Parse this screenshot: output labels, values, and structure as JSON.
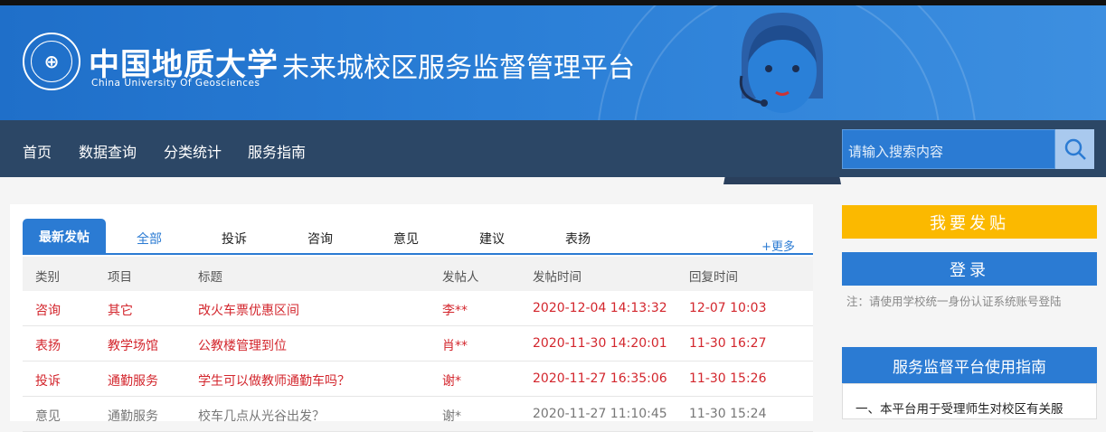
{
  "header": {
    "logo_cn": "中国地质大学",
    "logo_en": "China University Of Geosciences",
    "site_title": "未来城校区服务监督管理平台"
  },
  "nav": {
    "items": [
      "首页",
      "数据查询",
      "分类统计",
      "服务指南"
    ]
  },
  "search": {
    "placeholder": "请输入搜索内容"
  },
  "tabs": {
    "items": [
      "最新发帖",
      "全部",
      "投诉",
      "咨询",
      "意见",
      "建议",
      "表扬"
    ],
    "more": "+更多"
  },
  "table": {
    "headers": [
      "类别",
      "项目",
      "标题",
      "发帖人",
      "发帖时间",
      "回复时间"
    ],
    "rows": [
      [
        "咨询",
        "其它",
        "改火车票优惠区间",
        "李**",
        "2020-12-04 14:13:32",
        "12-07 10:03"
      ],
      [
        "表扬",
        "教学场馆",
        "公教楼管理到位",
        "肖**",
        "2020-11-30 14:20:01",
        "11-30 16:27"
      ],
      [
        "投诉",
        "通勤服务",
        "学生可以做教师通勤车吗？",
        "谢*",
        "2020-11-27 16:35:06",
        "11-30 15:26"
      ],
      [
        "意见",
        "通勤服务",
        "校车几点从光谷出发？",
        "谢*",
        "2020-11-27 11:10:45",
        "11-30 15:24"
      ]
    ]
  },
  "sidebar": {
    "post_button": "我要发贴",
    "login_button": "登录",
    "note": "注：请使用学校统一身份认证系统账号登陆",
    "guide_title": "服务监督平台使用指南",
    "guide_text": "一、本平台用于受理师生对校区有关服"
  },
  "colors": {
    "accent": "#2b7bd3",
    "nav": "#2c4766",
    "post": "#fbb900",
    "row_text": "#d3262d"
  }
}
